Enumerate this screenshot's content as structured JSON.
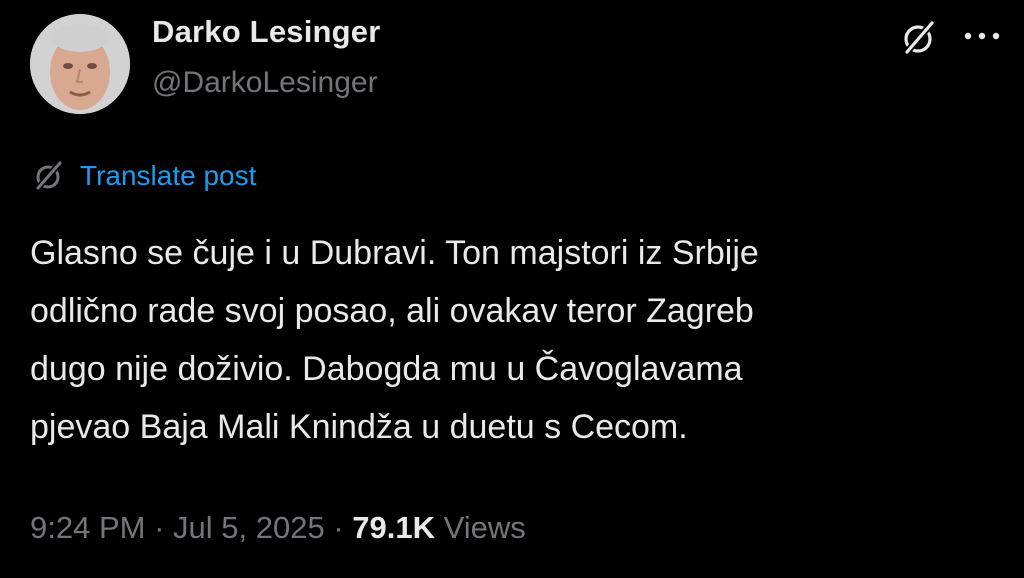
{
  "author": {
    "display_name": "Darko Lesinger",
    "handle": "@DarkoLesinger",
    "avatar_icon": "profile-photo"
  },
  "header_actions": {
    "grok_icon": "grok-icon",
    "more_icon": "more-dots-icon"
  },
  "translate": {
    "icon": "grok-icon",
    "label": "Translate post"
  },
  "post": {
    "lines": [
      "Glasno se čuje i u Dubravi. Ton majstori iz Srbije",
      "odlično rade svoj posao, ali ovakav teror Zagreb",
      "dugo nije doživio. Dabogda mu u Čavoglavama",
      "pjevao Baja Mali Knindža u duetu s Cecom."
    ]
  },
  "meta": {
    "time": "9:24 PM",
    "separator": "·",
    "date": "Jul 5, 2025",
    "views_count": "79.1K",
    "views_label": "Views"
  },
  "colors": {
    "background": "#000000",
    "text": "#e7e9ea",
    "muted": "#71767b",
    "link": "#1d9bf0"
  }
}
